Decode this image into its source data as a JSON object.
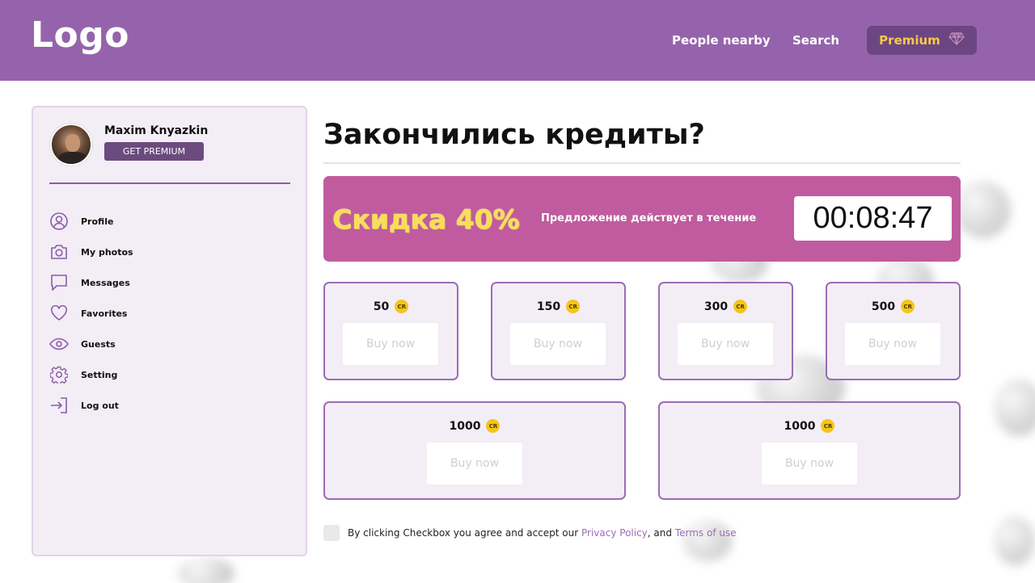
{
  "header": {
    "logo": "Logo",
    "nav": [
      "People nearby",
      "Search"
    ],
    "premium_label": "Premium",
    "premium_icon": "diamond-icon",
    "bg_color": "#9563ab",
    "accent_color": "#f7c948"
  },
  "sidebar": {
    "user_name": "Maxim Knyazkin",
    "get_premium": "GET PREMIUM",
    "items": [
      {
        "label": "Profile",
        "icon": "user-icon"
      },
      {
        "label": "My photos",
        "icon": "camera-icon"
      },
      {
        "label": "Messages",
        "icon": "message-icon"
      },
      {
        "label": "Favorites",
        "icon": "heart-icon"
      },
      {
        "label": "Guests",
        "icon": "eye-icon"
      },
      {
        "label": "Setting",
        "icon": "gear-icon"
      },
      {
        "label": "Log out",
        "icon": "logout-icon"
      }
    ]
  },
  "main": {
    "title": "Закончились кредиты?",
    "promo": {
      "discount": "Скидка 40%",
      "text": "Предложение действует в течение",
      "timer": "00:08:47",
      "bg_color": "#c05b9f"
    },
    "coin_label": "CR",
    "packages": [
      {
        "amount": "50",
        "button": "Buy now"
      },
      {
        "amount": "150",
        "button": "Buy now"
      },
      {
        "amount": "300",
        "button": "Buy now"
      },
      {
        "amount": "500",
        "button": "Buy now"
      },
      {
        "amount": "1000",
        "button": "Buy now"
      },
      {
        "amount": "1000",
        "button": "Buy now"
      }
    ],
    "agreement": {
      "prefix": "By clicking Checkbox you agree and accept our ",
      "privacy": "Privacy Policy",
      "middle": ", and ",
      "terms": "Terms of use"
    }
  }
}
